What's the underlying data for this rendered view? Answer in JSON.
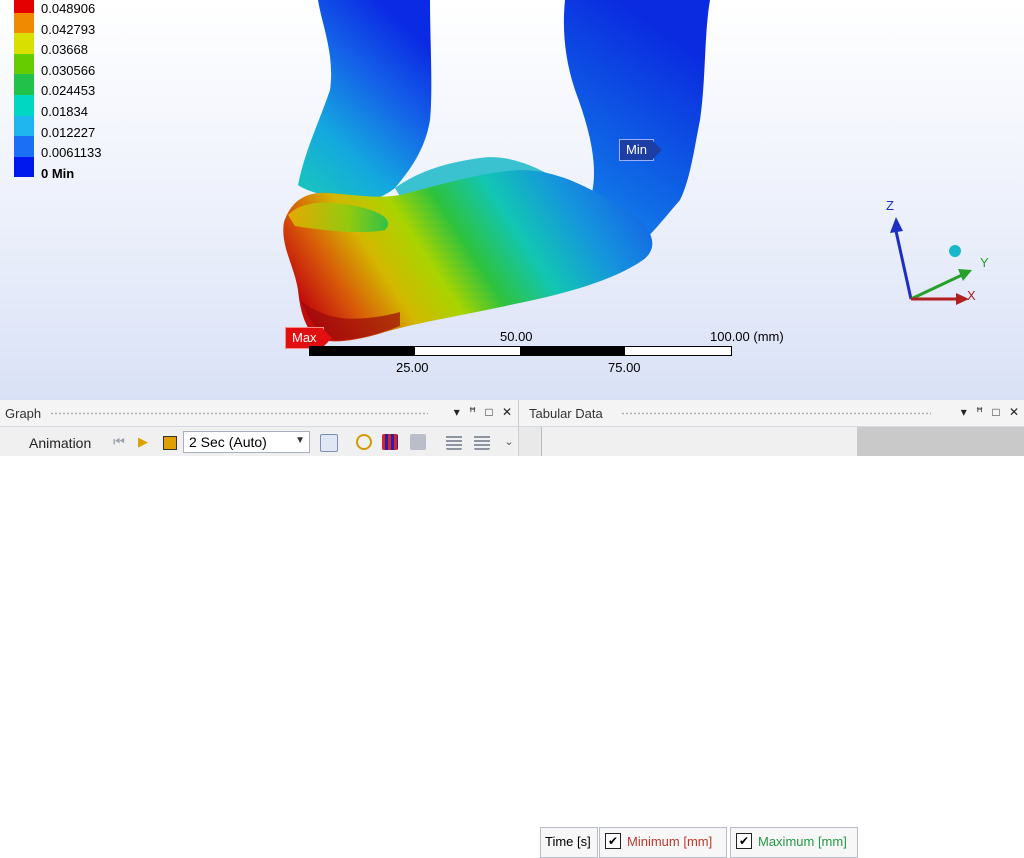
{
  "legend": {
    "colors": [
      "#e40000",
      "#f08a00",
      "#d9df00",
      "#66cc00",
      "#22c24a",
      "#00d7c3",
      "#1fb6f0",
      "#1b6ff2",
      "#0018ee"
    ],
    "values": [
      "0.048906",
      "0.042793",
      "0.03668",
      "0.030566",
      "0.024453",
      "0.01834",
      "0.012227",
      "0.0061133",
      "0 Min"
    ]
  },
  "probes": {
    "min_label": "Min",
    "max_label": "Max"
  },
  "scale": {
    "top_labels": [
      "50.00",
      "100.00 (mm)"
    ],
    "bottom_labels": [
      "25.00",
      "75.00"
    ]
  },
  "triad": {
    "z": "Z",
    "y": "Y",
    "x": "X"
  },
  "graph_panel": {
    "title": "Graph",
    "animation_label": "Animation",
    "speed_value": "2 Sec (Auto)",
    "controls": [
      "▾",
      "ꟸ",
      "□",
      "✕"
    ]
  },
  "tabular_panel": {
    "title": "Tabular Data",
    "controls": [
      "▾",
      "ꟸ",
      "□",
      "✕"
    ],
    "columns": [
      {
        "label": "Time [s]"
      },
      {
        "label": "Minimum [mm]",
        "checked": true,
        "color": "#c0392b"
      },
      {
        "label": "Maximum [mm]",
        "checked": true,
        "color": "#229944"
      }
    ]
  }
}
